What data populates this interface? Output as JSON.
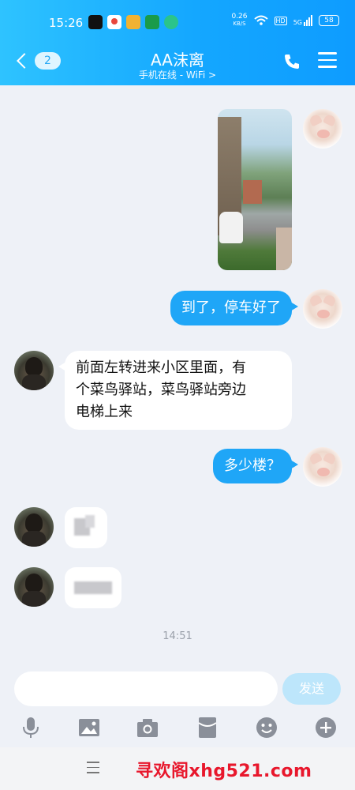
{
  "status_bar": {
    "time": "15:26",
    "net_speed_value": "0.26",
    "net_speed_unit": "KB/S",
    "network": "5G",
    "hd": "HD",
    "battery": "58",
    "app_icons": [
      {
        "name": "tiktok-icon",
        "color": "#111111"
      },
      {
        "name": "map-pin-app-icon",
        "color": "#e8463c"
      },
      {
        "name": "shield-app-icon",
        "color": "#f0b232"
      },
      {
        "name": "green-app-icon",
        "color": "#1a9b4a"
      },
      {
        "name": "chat-app-icon",
        "color": "#2bc48a"
      }
    ]
  },
  "header": {
    "back_count": "2",
    "title": "AA沫离",
    "subtitle": "手机在线 - WiFi >"
  },
  "messages": [
    {
      "type": "image",
      "from": "me",
      "alt": "street photo"
    },
    {
      "type": "text",
      "from": "me",
      "text": "到了，停车好了"
    },
    {
      "type": "text",
      "from": "them",
      "lines": [
        "前面左转进来小区里面，有",
        "个菜鸟驿站，菜鸟驿站旁边",
        "电梯上来"
      ]
    },
    {
      "type": "text",
      "from": "me",
      "text": "多少楼？"
    },
    {
      "type": "blurred",
      "from": "them"
    },
    {
      "type": "blurred",
      "from": "them"
    }
  ],
  "time_separator": "14:51",
  "composer": {
    "placeholder": "",
    "send_label": "发送"
  },
  "toolbar": {
    "tools": [
      "microphone-icon",
      "image-icon",
      "camera-icon",
      "red-packet-icon",
      "emoji-icon",
      "plus-icon"
    ]
  },
  "watermark": "寻欢阁xhg521.com",
  "colors": {
    "accent": "#1fa6f7",
    "header_gradient_start": "#2ec3ff",
    "header_gradient_end": "#0e9cff",
    "chat_background": "#eef1f7",
    "watermark": "#e8172c"
  }
}
